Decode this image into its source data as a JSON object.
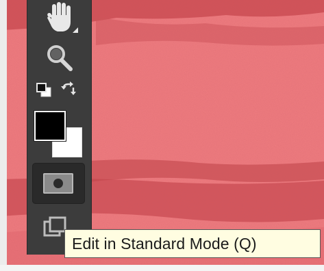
{
  "tools": {
    "hand": "hand-icon",
    "zoom": "zoom-icon",
    "default_colors": "default-colors-icon",
    "swap_colors": "swap-colors-icon",
    "quick_mask": "quick-mask-icon",
    "screen_mode": "screen-mode-icon"
  },
  "colors": {
    "foreground": "#000000",
    "background": "#ffffff",
    "quick_mask_overlay": "#ef7c80",
    "toolbar": "#3c3c3c"
  },
  "tooltip": {
    "text": "Edit in Standard Mode (Q)"
  }
}
